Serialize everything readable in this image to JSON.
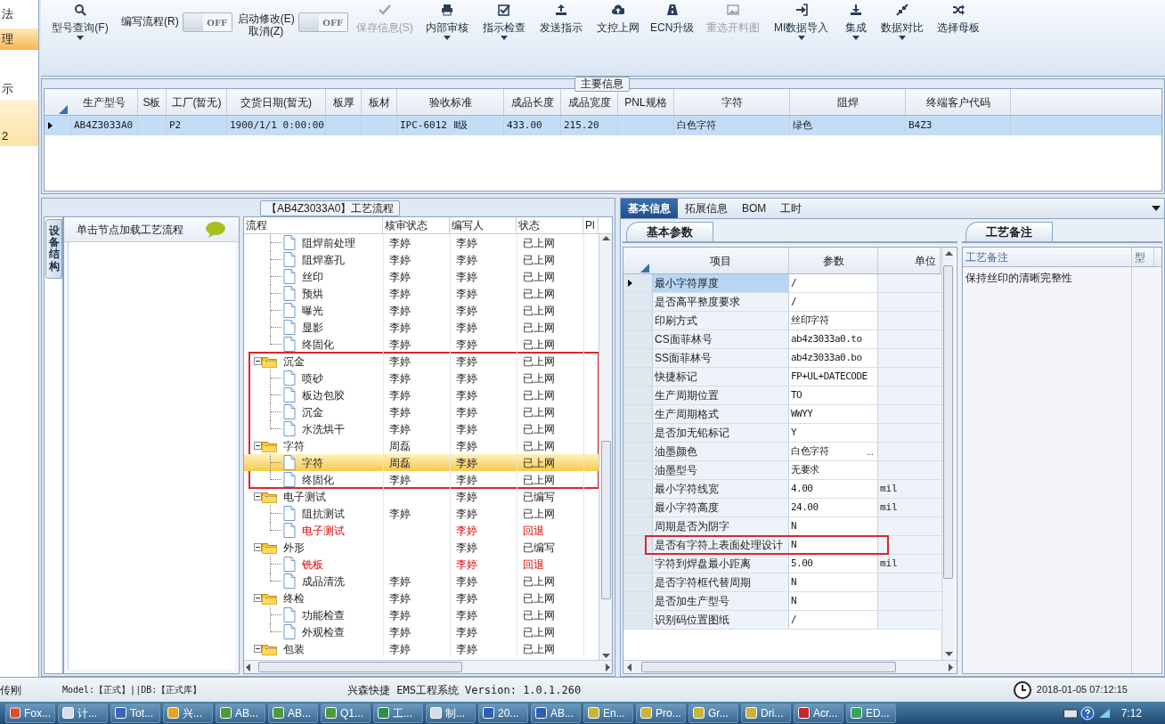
{
  "left_nav": [
    {
      "label": "法",
      "selected": false
    },
    {
      "label": "理",
      "selected": true
    },
    {
      "label": "示",
      "selected": false
    },
    {
      "label": "2",
      "selected": true
    }
  ],
  "toolbar": [
    {
      "kind": "button",
      "label": "型号查询(F)",
      "dropdown": true,
      "disabled": false
    },
    {
      "kind": "toggle",
      "label": "编写流程(R)",
      "state_text": "OFF",
      "on": false
    },
    {
      "kind": "toggle",
      "label": "启动修改(E)\n取消(Z)",
      "state_text": "OFF",
      "on": false
    },
    {
      "kind": "button",
      "label": "保存信息(S)",
      "dropdown": false,
      "disabled": true
    },
    {
      "kind": "button",
      "label": "内部审核",
      "dropdown": true,
      "disabled": false
    },
    {
      "kind": "button",
      "label": "指示检查",
      "dropdown": true,
      "disabled": false
    },
    {
      "kind": "button",
      "label": "发送指示",
      "dropdown": false,
      "disabled": false
    },
    {
      "kind": "button",
      "label": "文控上网",
      "dropdown": false,
      "disabled": false
    },
    {
      "kind": "button",
      "label": "ECN升级",
      "dropdown": false,
      "disabled": false
    },
    {
      "kind": "button",
      "label": "重选开料图",
      "dropdown": false,
      "disabled": true
    },
    {
      "kind": "button",
      "label": "MI数据导入",
      "dropdown": true,
      "disabled": false
    },
    {
      "kind": "button",
      "label": "集成",
      "dropdown": true,
      "disabled": false
    },
    {
      "kind": "button",
      "label": "数据对比",
      "dropdown": true,
      "disabled": false
    },
    {
      "kind": "button",
      "label": "选择母板",
      "dropdown": false,
      "disabled": false
    }
  ],
  "main_info": {
    "title": "主要信息",
    "columns": [
      "生产型号",
      "S板",
      "工厂(暂无)",
      "交货日期(暂无)",
      "板厚",
      "板材",
      "验收标准",
      "成品长度",
      "成品宽度",
      "PNL规格",
      "字符",
      "阻焊",
      "终端客户代码"
    ],
    "rows": [
      {
        "selected": true,
        "cells": [
          "AB4Z3033A0",
          "",
          "P2",
          "1900/1/1 0:00:00",
          "",
          "",
          "IPC-6012 Ⅱ级",
          "433.00",
          "215.20",
          "",
          "白色字符",
          "绿色",
          "B4Z3"
        ]
      }
    ]
  },
  "flow_panel": {
    "title": "【AB4Z3033A0】工艺流程",
    "side_tab": "设备结构",
    "hint": "单击节点加载工艺流程",
    "columns": [
      "流程",
      "核审状态",
      "编写人",
      "状态",
      "Pl"
    ],
    "tree": [
      {
        "kind": "continuation",
        "children": [
          {
            "label": "阻焊前处理",
            "reviewer": "李婷",
            "writer": "李婷",
            "status": "已上网",
            "error": false,
            "selected": false
          },
          {
            "label": "阻焊塞孔",
            "reviewer": "李婷",
            "writer": "李婷",
            "status": "已上网",
            "error": false,
            "selected": false
          },
          {
            "label": "丝印",
            "reviewer": "李婷",
            "writer": "李婷",
            "status": "已上网",
            "error": false,
            "selected": false
          },
          {
            "label": "预烘",
            "reviewer": "李婷",
            "writer": "李婷",
            "status": "已上网",
            "error": false,
            "selected": false
          },
          {
            "label": "曝光",
            "reviewer": "李婷",
            "writer": "李婷",
            "status": "已上网",
            "error": false,
            "selected": false
          },
          {
            "label": "显影",
            "reviewer": "李婷",
            "writer": "李婷",
            "status": "已上网",
            "error": false,
            "selected": false
          },
          {
            "label": "终固化",
            "reviewer": "李婷",
            "writer": "李婷",
            "status": "已上网",
            "error": false,
            "selected": false
          }
        ]
      },
      {
        "kind": "group",
        "label": "沉金",
        "reviewer": "李婷",
        "writer": "李婷",
        "status": "已上网",
        "error": false,
        "selected": false,
        "highlighted": true,
        "expanded": true,
        "children": [
          {
            "label": "喷砂",
            "reviewer": "李婷",
            "writer": "李婷",
            "status": "已上网",
            "error": false,
            "selected": false
          },
          {
            "label": "板边包胶",
            "reviewer": "李婷",
            "writer": "李婷",
            "status": "已上网",
            "error": false,
            "selected": false
          },
          {
            "label": "沉金",
            "reviewer": "李婷",
            "writer": "李婷",
            "status": "已上网",
            "error": false,
            "selected": false
          },
          {
            "label": "水洗烘干",
            "reviewer": "李婷",
            "writer": "李婷",
            "status": "已上网",
            "error": false,
            "selected": false
          }
        ]
      },
      {
        "kind": "group",
        "label": "字符",
        "reviewer": "周磊",
        "writer": "李婷",
        "status": "已上网",
        "error": false,
        "selected": false,
        "highlighted": true,
        "expanded": true,
        "children": [
          {
            "label": "字符",
            "reviewer": "周磊",
            "writer": "李婷",
            "status": "已上网",
            "error": false,
            "selected": true
          },
          {
            "label": "终固化",
            "reviewer": "李婷",
            "writer": "李婷",
            "status": "已上网",
            "error": false,
            "selected": false
          }
        ]
      },
      {
        "kind": "group",
        "label": "电子测试",
        "writer": "李婷",
        "status": "已编写",
        "error": false,
        "selected": false,
        "highlighted": false,
        "expanded": true,
        "children": [
          {
            "label": "阻抗测试",
            "reviewer": "李婷",
            "writer": "李婷",
            "status": "已上网",
            "error": false,
            "selected": false
          },
          {
            "label": "电子测试",
            "writer": "李婷",
            "status": "回退",
            "error": true,
            "selected": false
          }
        ]
      },
      {
        "kind": "group",
        "label": "外形",
        "writer": "李婷",
        "status": "已编写",
        "error": false,
        "selected": false,
        "highlighted": false,
        "expanded": true,
        "children": [
          {
            "label": "铣板",
            "writer": "李婷",
            "status": "回退",
            "error": true,
            "selected": false
          },
          {
            "label": "成品清洗",
            "reviewer": "李婷",
            "writer": "李婷",
            "status": "已上网",
            "error": false,
            "selected": false
          }
        ]
      },
      {
        "kind": "group",
        "label": "终检",
        "reviewer": "李婷",
        "writer": "李婷",
        "status": "已上网",
        "error": false,
        "selected": false,
        "highlighted": false,
        "expanded": true,
        "children": [
          {
            "label": "功能检查",
            "reviewer": "李婷",
            "writer": "李婷",
            "status": "已上网",
            "error": false,
            "selected": false
          },
          {
            "label": "外观检查",
            "reviewer": "李婷",
            "writer": "李婷",
            "status": "已上网",
            "error": false,
            "selected": false
          }
        ]
      },
      {
        "kind": "group",
        "label": "包装",
        "reviewer": "李婷",
        "writer": "李婷",
        "status": "已上网",
        "error": false,
        "selected": false,
        "highlighted": false,
        "expanded": true
      }
    ]
  },
  "detail_tabs": [
    {
      "label": "基本信息",
      "selected": true
    },
    {
      "label": "拓展信息",
      "selected": false
    },
    {
      "label": "BOM",
      "selected": false
    },
    {
      "label": "工时",
      "selected": false
    }
  ],
  "params": {
    "tab": "基本参数",
    "columns": [
      "项目",
      "参数",
      "单位"
    ],
    "rows": [
      {
        "item": "最小字符厚度",
        "value": "/",
        "unit": "",
        "selected": true,
        "outlined": false
      },
      {
        "item": "是否高平整度要求",
        "value": "/",
        "unit": "",
        "selected": false,
        "outlined": false
      },
      {
        "item": "印刷方式",
        "value": "丝印字符",
        "unit": "",
        "selected": false,
        "outlined": false
      },
      {
        "item": "CS面菲林号",
        "value": "ab4z3033a0.to",
        "unit": "",
        "selected": false,
        "outlined": false
      },
      {
        "item": "SS面菲林号",
        "value": "ab4z3033a0.bo",
        "unit": "",
        "selected": false,
        "outlined": false
      },
      {
        "item": "快捷标记",
        "value": "FP+UL+DATECODE",
        "unit": "",
        "selected": false,
        "outlined": false
      },
      {
        "item": "生产周期位置",
        "value": "TO",
        "unit": "",
        "selected": false,
        "outlined": false
      },
      {
        "item": "生产周期格式",
        "value": "WWYY",
        "unit": "",
        "selected": false,
        "outlined": false
      },
      {
        "item": "是否加无铅标记",
        "value": "Y",
        "unit": "",
        "selected": false,
        "outlined": false
      },
      {
        "item": "油墨颜色",
        "value": "白色字符",
        "unit": "",
        "picker": "...",
        "selected": false,
        "outlined": false
      },
      {
        "item": "油墨型号",
        "value": "无要求",
        "unit": "",
        "selected": false,
        "outlined": false
      },
      {
        "item": "最小字符线宽",
        "value": "4.00",
        "unit": "mil",
        "selected": false,
        "outlined": false
      },
      {
        "item": "最小字符高度",
        "value": "24.00",
        "unit": "mil",
        "selected": false,
        "outlined": false
      },
      {
        "item": "周期是否为阴字",
        "value": "N",
        "unit": "",
        "selected": false,
        "outlined": false
      },
      {
        "item": "是否有字符上表面处理设计",
        "value": "N",
        "unit": "",
        "selected": false,
        "outlined": true
      },
      {
        "item": "字符到焊盘最小距离",
        "value": "5.00",
        "unit": "mil",
        "selected": false,
        "outlined": false
      },
      {
        "item": "是否字符框代替周期",
        "value": "N",
        "unit": "",
        "selected": false,
        "outlined": false
      },
      {
        "item": "是否加生产型号",
        "value": "N",
        "unit": "",
        "selected": false,
        "outlined": false
      },
      {
        "item": "识别码位置图纸",
        "value": "/",
        "unit": "",
        "selected": false,
        "outlined": false
      }
    ]
  },
  "notes": {
    "tab": "工艺备注",
    "columns": [
      "工艺备注",
      "型"
    ],
    "text": "保持丝印的清晰完整性"
  },
  "status_bar": {
    "user": "传刚",
    "env": "Model:【正式】||DB:【正式库】",
    "system": "兴森快捷 EMS工程系统 Version: 1.0.1.260",
    "datetime": "2018-01-05 07:12:15"
  },
  "taskbar": {
    "items": [
      "Fox...",
      "计...",
      "Tot...",
      "兴...",
      "AB...",
      "AB...",
      "Q1...",
      "工...",
      "制...",
      "20...",
      "AB...",
      "En...",
      "Pro...",
      "Gr...",
      "Dri...",
      "Acr...",
      "ED..."
    ],
    "clock": "7:12"
  }
}
